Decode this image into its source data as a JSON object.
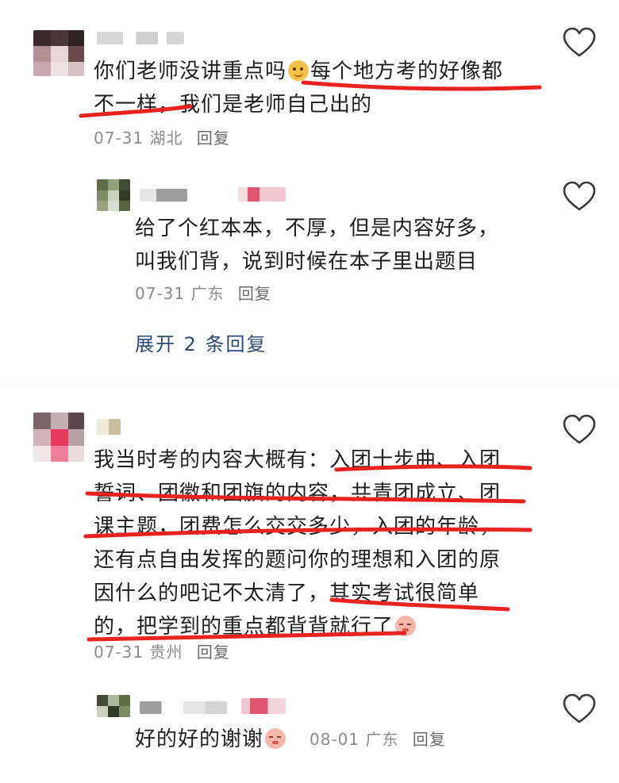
{
  "comments": [
    {
      "text_line1": "你们老师没讲重点吗",
      "text_line1b": "每个地方考的好像都",
      "text_line2": "不一样，我们是老师自己出的",
      "date": "07-31",
      "region": "湖北",
      "reply": "回复"
    },
    {
      "text_line1": "给了个红本本，不厚，但是内容好多，",
      "text_line2": "叫我们背，说到时候在本子里出题目",
      "date": "07-31",
      "region": "广东",
      "reply": "回复"
    },
    {
      "text_line1": "我当时考的内容大概有：入团十步曲、入团",
      "text_line2": "誓词、团徽和团旗的内容，共青团成立、团",
      "text_line3": "课主题，团费怎么交交多少，入团的年龄，",
      "text_line4": "还有点自由发挥的题问你的理想和入团的原",
      "text_line5": "因什么的吧记不太清了，其实考试很简单",
      "text_line6": "的，把学到的重点都背背就行了",
      "date": "07-31",
      "region": "贵州",
      "reply": "回复"
    },
    {
      "text": "好的好的谢谢",
      "date": "08-01",
      "region": "广东",
      "reply": "回复"
    }
  ],
  "expand_replies": "展开 2 条回复",
  "icons": {
    "like": "heart-outline-icon",
    "emoji_smile": "smile-emoji-icon",
    "emoji_shy": "shy-emoji-icon"
  },
  "colors": {
    "annotation": "#e8231f",
    "link": "#2b4b7a",
    "meta": "#8c8c8c"
  }
}
